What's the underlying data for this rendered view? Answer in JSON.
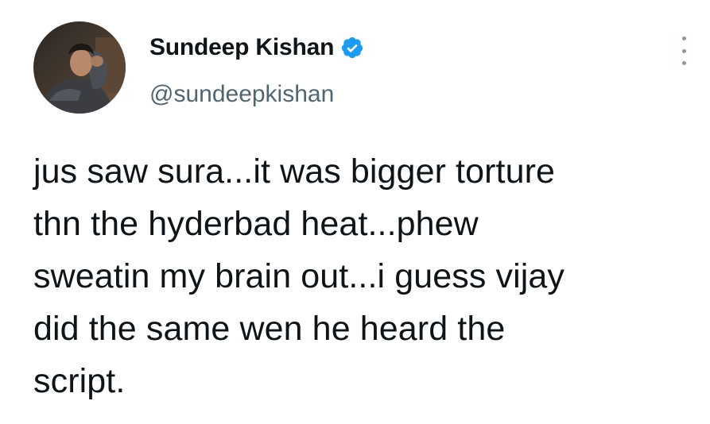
{
  "tweet": {
    "author": {
      "display_name": "Sundeep Kishan",
      "handle": "@sundeepkishan",
      "verified": true,
      "avatar_icon": "profile-photo"
    },
    "text_lines": [
      "jus saw sura...it was bigger torture",
      "thn the hyderbad heat...phew",
      "sweatin my brain out...i guess vijay",
      "did the same wen he heard the",
      "script."
    ],
    "more_icon": "vertical-ellipsis-icon"
  },
  "colors": {
    "text": "#0f1419",
    "secondary_text": "#536471",
    "verified_badge": "#1d9bf0",
    "background": "#ffffff"
  }
}
